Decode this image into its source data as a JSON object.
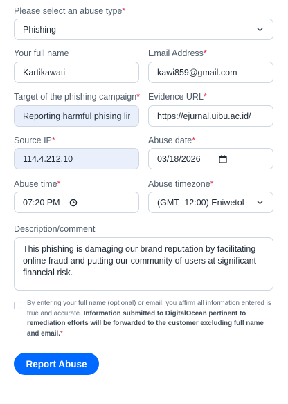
{
  "form": {
    "abuse_type": {
      "label": "Please select an abuse type",
      "value": "Phishing",
      "icon": "chevron-down-icon"
    },
    "full_name": {
      "label": "Your full name",
      "value": "Kartikawati"
    },
    "email": {
      "label": "Email Address",
      "value": "kawi859@gmail.com"
    },
    "target": {
      "label": "Target of the phishing campaign",
      "value": "Reporting harmful phising link"
    },
    "evidence_url": {
      "label": "Evidence URL",
      "value": "https://ejurnal.uibu.ac.id/"
    },
    "source_ip": {
      "label": "Source IP",
      "value": "114.4.212.10"
    },
    "abuse_date": {
      "label": "Abuse date",
      "value": "03/18/2026",
      "icon": "calendar-icon"
    },
    "abuse_time": {
      "label": "Abuse time",
      "value": "07:20 PM",
      "icon": "clock-icon"
    },
    "abuse_timezone": {
      "label": "Abuse timezone",
      "value": "(GMT -12:00) Eniwetok",
      "icon": "chevron-down-icon"
    },
    "description": {
      "label": "Description/comment",
      "value": "This phishing is damaging our brand reputation by facilitating online fraud and putting our community of users at significant financial risk."
    },
    "consent": {
      "checked": false,
      "text_regular": "By entering your full name (optional) or email, you affirm all information entered is true and accurate.",
      "text_bold": "Information submitted to DigitalOcean pertinent to remediation efforts will be forwarded to the customer excluding full name and email."
    },
    "required_mark": "*",
    "submit_label": "Report Abuse"
  },
  "colors": {
    "accent": "#0069ff",
    "required": "#e0304e",
    "filled_field_bg": "#e9f0fb"
  }
}
